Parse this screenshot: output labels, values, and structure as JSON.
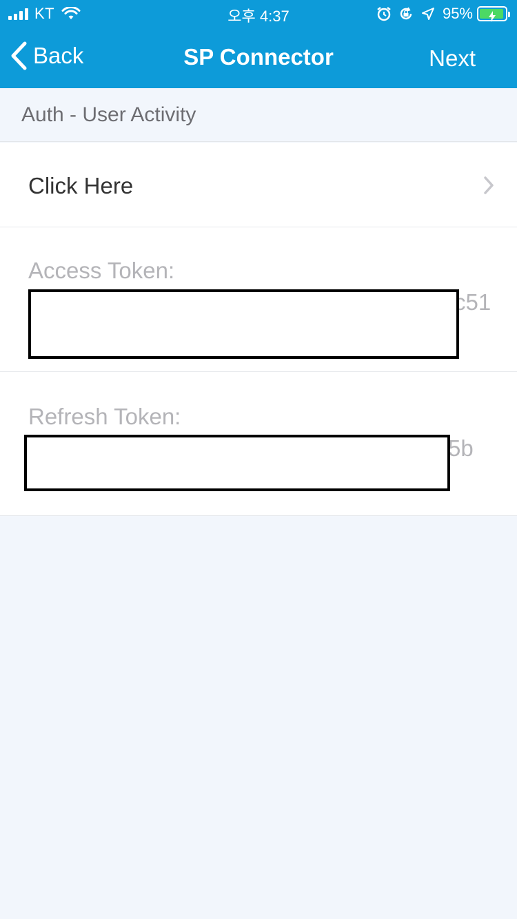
{
  "status_bar": {
    "carrier": "KT",
    "time": "오후 4:37",
    "battery_percent": "95%",
    "icons": [
      "signal-icon",
      "wifi-icon",
      "alarm-icon",
      "rotation-lock-icon",
      "location-arrow-icon",
      "battery-charging-icon"
    ]
  },
  "nav": {
    "back_label": "Back",
    "title": "SP Connector",
    "next_label": "Next"
  },
  "section": {
    "header": "Auth - User Activity"
  },
  "rows": {
    "click_here": "Click Here",
    "access_token_label": "Access Token:",
    "access_token_visible_tail": "c51",
    "refresh_token_label": "Refresh Token:",
    "refresh_token_visible_tail": "5b"
  },
  "colors": {
    "nav_bar": "#0d9bd9",
    "background": "#f2f6fc",
    "battery_fill": "#4cd964"
  }
}
